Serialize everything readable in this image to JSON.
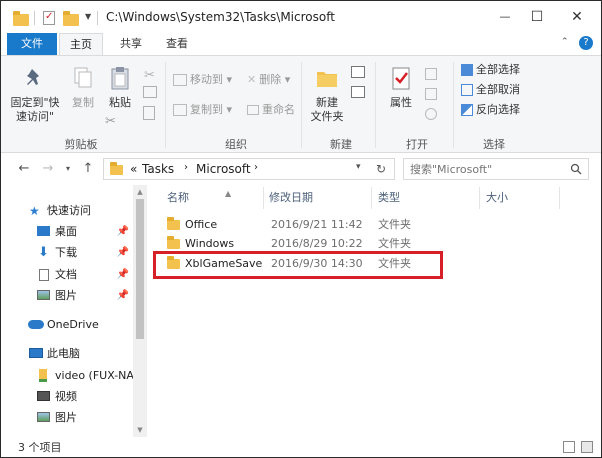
{
  "window": {
    "title": "C:\\Windows\\System32\\Tasks\\Microsoft",
    "minimize": "—",
    "maximize": "☐",
    "close": "✕"
  },
  "ribbon_tabs": [
    {
      "label": "文件"
    },
    {
      "label": "主页"
    },
    {
      "label": "共享"
    },
    {
      "label": "查看"
    }
  ],
  "ribbon": {
    "help_glyph": "?",
    "clipboard": {
      "pin_line1": "固定到\"快",
      "pin_line2": "速访问\"",
      "copy": "复制",
      "paste": "粘贴",
      "group": "剪贴板"
    },
    "organize": {
      "move_to": "移动到",
      "copy_to": "复制到",
      "delete": "删除",
      "rename": "重命名",
      "group": "组织"
    },
    "new": {
      "new_folder_line1": "新建",
      "new_folder_line2": "文件夹",
      "group": "新建"
    },
    "open": {
      "properties": "属性",
      "group": "打开"
    },
    "select": {
      "select_all": "全部选择",
      "select_none": "全部取消",
      "invert": "反向选择",
      "group": "选择"
    }
  },
  "address": {
    "chevrons": "«",
    "crumb1": "Tasks",
    "crumb2": "Microsoft",
    "search_placeholder": "搜索\"Microsoft\""
  },
  "nav_pane": {
    "quick_access": "快速访问",
    "desktop": "桌面",
    "downloads": "下载",
    "documents": "文档",
    "pictures": "图片",
    "onedrive": "OneDrive",
    "this_pc": "此电脑",
    "video_drive": "video (FUX-NA",
    "videos": "视频",
    "pictures2": "图片"
  },
  "columns": {
    "name": "名称",
    "modified": "修改日期",
    "type": "类型",
    "size": "大小"
  },
  "files": [
    {
      "name": "Office",
      "modified": "2016/9/21 11:42",
      "type": "文件夹"
    },
    {
      "name": "Windows",
      "modified": "2016/8/29 10:22",
      "type": "文件夹"
    },
    {
      "name": "XblGameSave",
      "modified": "2016/9/30 14:30",
      "type": "文件夹"
    }
  ],
  "status": {
    "item_count": "3 个项目"
  },
  "colors": {
    "file_tab": "#1979ca",
    "folder": "#f2c14e",
    "highlight": "#d61f27"
  }
}
